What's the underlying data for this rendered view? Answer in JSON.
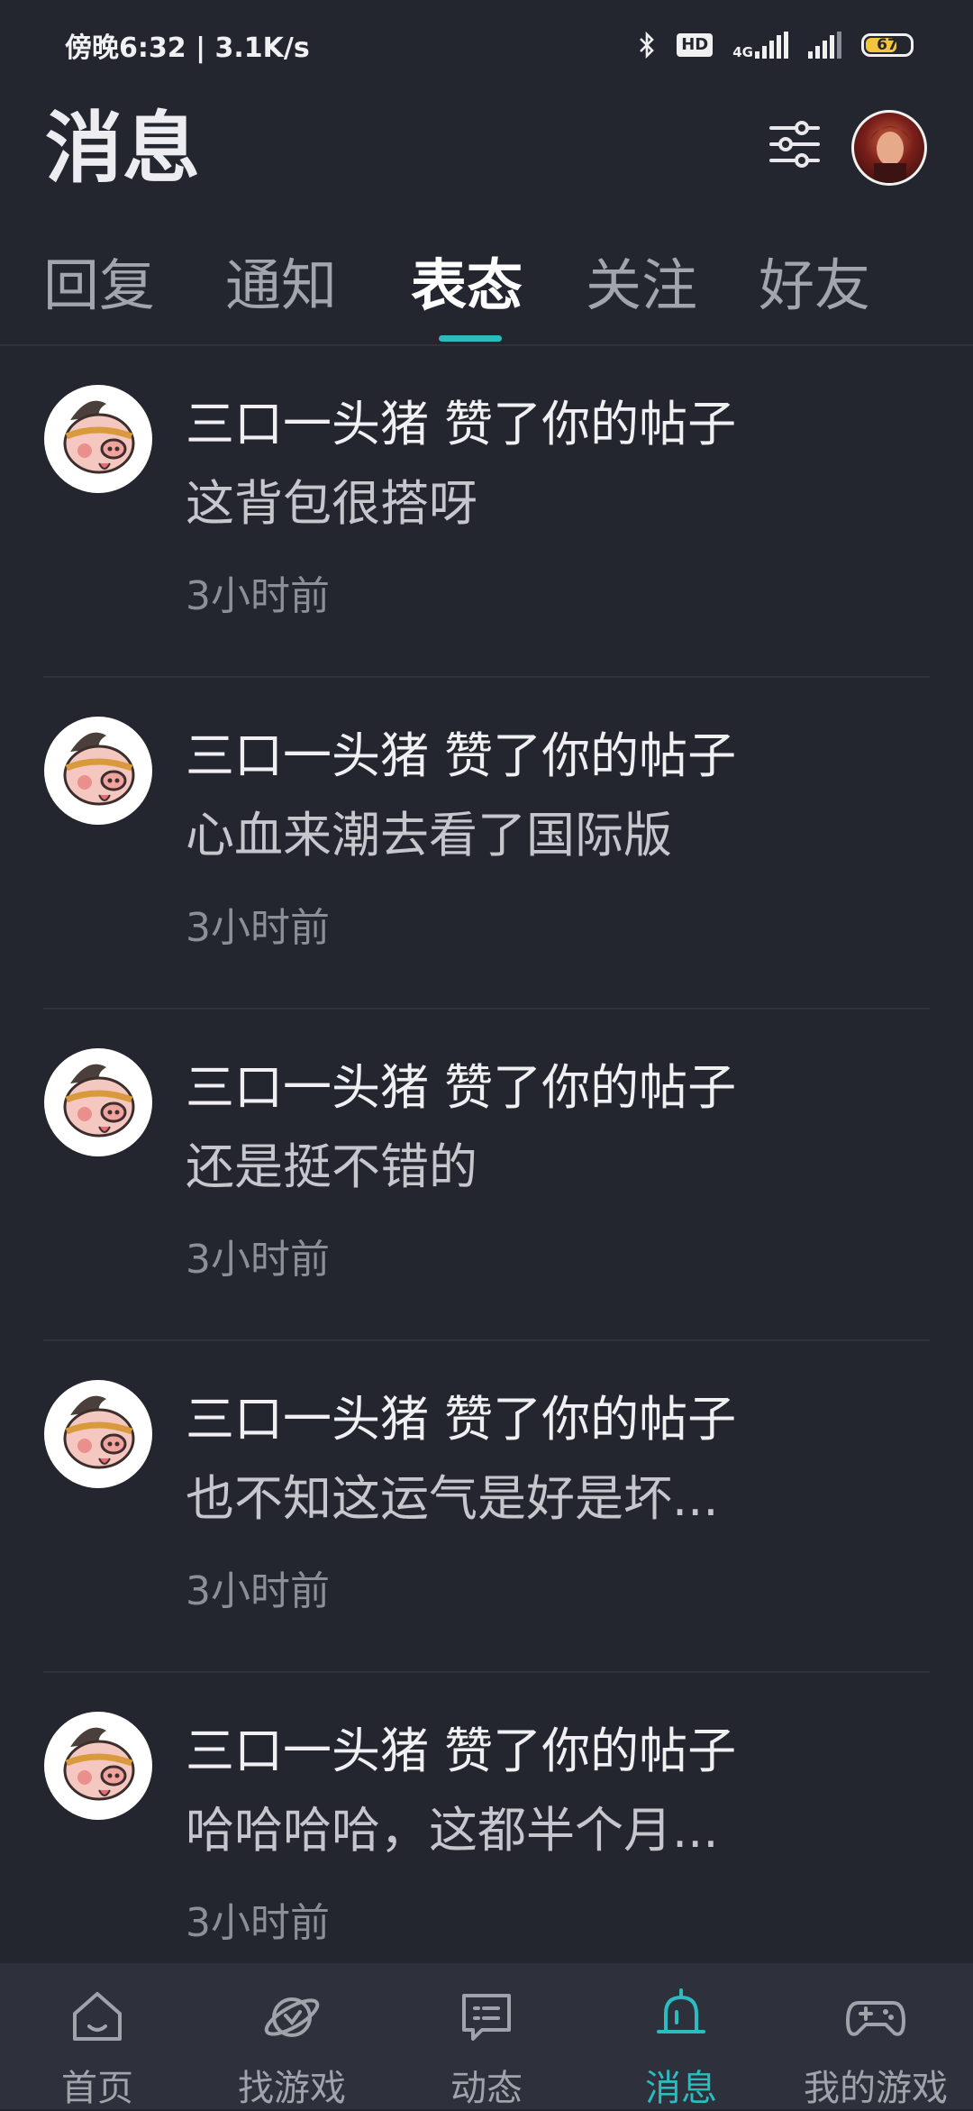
{
  "status_bar": {
    "time": "傍晚6:32 | 3.1K/s",
    "hd": "HD",
    "network": "4G",
    "battery": "67"
  },
  "header": {
    "title": "消息"
  },
  "tabs": [
    {
      "label": "回复",
      "active": false
    },
    {
      "label": "通知",
      "active": false
    },
    {
      "label": "表态",
      "active": true
    },
    {
      "label": "关注",
      "active": false
    },
    {
      "label": "好友",
      "active": false
    }
  ],
  "messages": [
    {
      "title": "三口一头猪 赞了你的帖子",
      "body": "这背包很搭呀",
      "time": "3小时前"
    },
    {
      "title": "三口一头猪 赞了你的帖子",
      "body": "心血来潮去看了国际版",
      "time": "3小时前"
    },
    {
      "title": "三口一头猪 赞了你的帖子",
      "body": "还是挺不错的",
      "time": "3小时前"
    },
    {
      "title": "三口一头猪 赞了你的帖子",
      "body": "也不知这运气是好是坏...",
      "time": "3小时前"
    },
    {
      "title": "三口一头猪 赞了你的帖子",
      "body": "哈哈哈哈，这都半个月...",
      "time": "3小时前"
    }
  ],
  "bottom_nav": [
    {
      "label": "首页",
      "icon": "home-icon"
    },
    {
      "label": "找游戏",
      "icon": "planet-icon"
    },
    {
      "label": "动态",
      "icon": "chat-icon"
    },
    {
      "label": "消息",
      "icon": "bell-icon",
      "active": true
    },
    {
      "label": "我的游戏",
      "icon": "gamepad-icon"
    }
  ],
  "colors": {
    "background": "#23252f",
    "accent": "#2bbcc0",
    "nav_background": "#2e303b"
  }
}
